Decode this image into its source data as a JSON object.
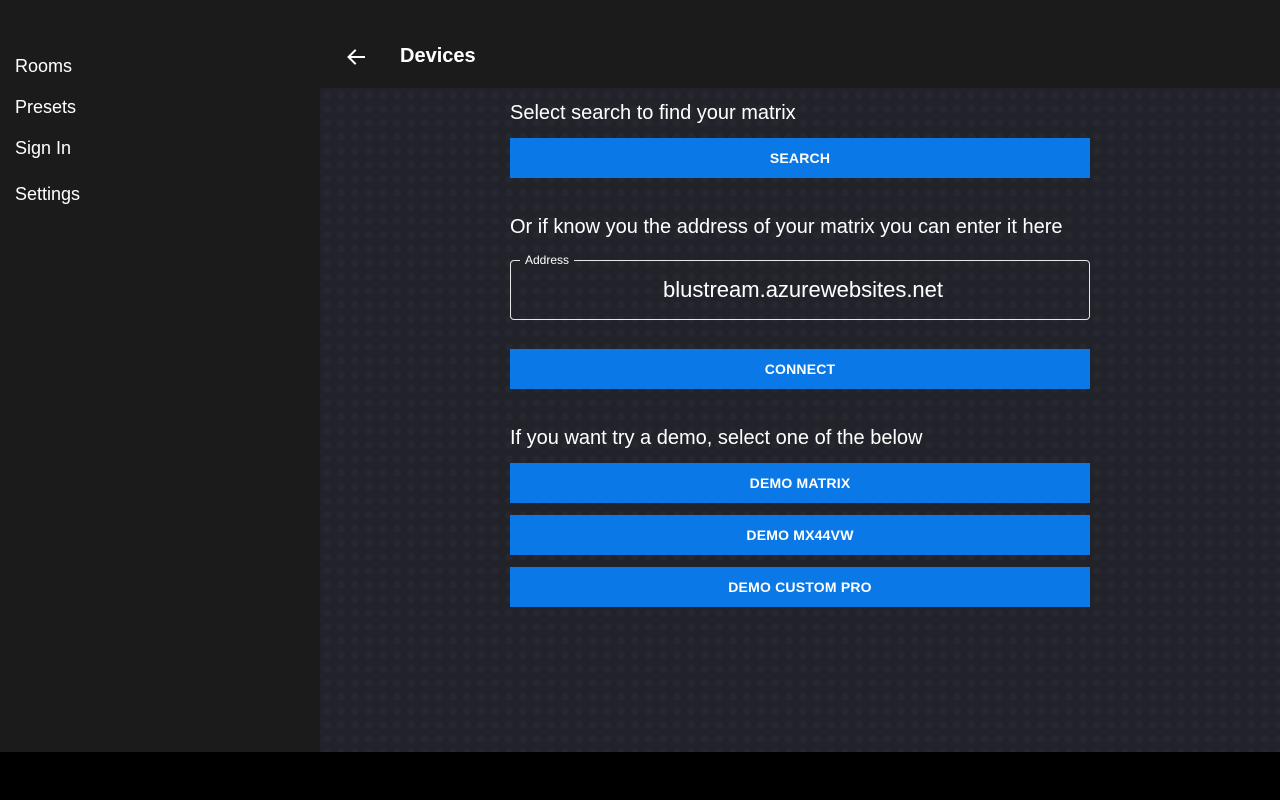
{
  "sidebar": {
    "items": [
      {
        "label": "Rooms"
      },
      {
        "label": "Presets"
      },
      {
        "label": "Sign In"
      },
      {
        "label": "Settings"
      }
    ]
  },
  "header": {
    "back_icon": "arrow-left-icon",
    "title": "Devices"
  },
  "main": {
    "search_heading": "Select search to find your matrix",
    "search_button": "SEARCH",
    "address_heading": "Or if know you the address of your matrix you can enter it here",
    "address_field": {
      "label": "Address",
      "value": "blustream.azurewebsites.net"
    },
    "connect_button": "CONNECT",
    "demo_heading": "If you want try a demo, select one of the below",
    "demo_buttons": [
      {
        "label": "DEMO MATRIX"
      },
      {
        "label": "DEMO MX44VW"
      },
      {
        "label": "DEMO CUSTOM PRO"
      }
    ]
  },
  "colors": {
    "accent": "#0a78e6",
    "sidebar_bg": "#1b1b1b",
    "content_bg": "#22232a"
  }
}
